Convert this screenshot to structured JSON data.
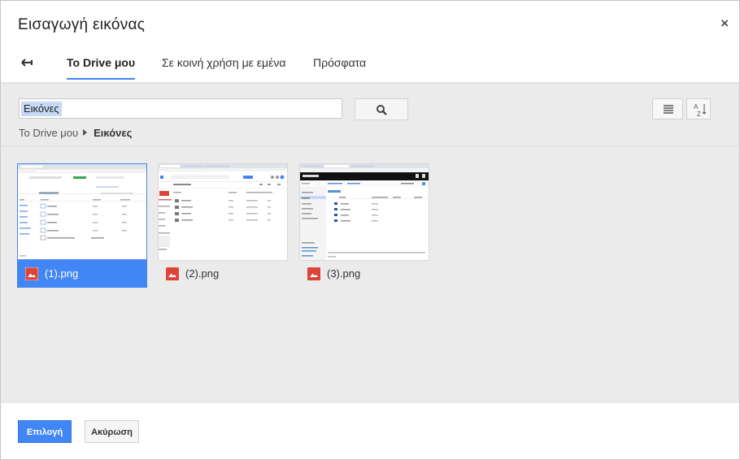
{
  "dialog": {
    "title": "Εισαγωγή εικόνας",
    "close_glyph": "×"
  },
  "tabs": [
    {
      "label": "Το Drive μου",
      "active": true
    },
    {
      "label": "Σε κοινή χρήση με εμένα",
      "active": false
    },
    {
      "label": "Πρόσφατα",
      "active": false
    }
  ],
  "search": {
    "value": "Εικόνες"
  },
  "breadcrumb": {
    "root": "Το Drive μου",
    "current": "Εικόνες"
  },
  "files": [
    {
      "name": "(1).png",
      "selected": true
    },
    {
      "name": "(2).png",
      "selected": false
    },
    {
      "name": "(3).png",
      "selected": false
    }
  ],
  "footer": {
    "select_label": "Επιλογή",
    "cancel_label": "Ακύρωση"
  },
  "colors": {
    "accent": "#4285f4",
    "image_icon": "#db4437"
  },
  "icons": {
    "back": "back-arrow-icon",
    "search": "search-icon",
    "list": "list-view-icon",
    "sort": "sort-az-icon",
    "file": "image-file-icon"
  }
}
